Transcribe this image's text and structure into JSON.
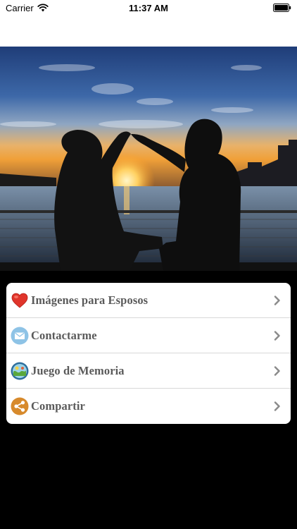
{
  "status_bar": {
    "carrier": "Carrier",
    "time": "11:37 AM"
  },
  "hero": {
    "image": "couple-silhouette-heart-sunset-photo"
  },
  "menu": {
    "items": [
      {
        "label": "Imágenes para Esposos",
        "icon": "heart-icon",
        "icon_color": "#e0352b"
      },
      {
        "label": "Contactarme",
        "icon": "mail-icon",
        "icon_color": "#8ec3e6"
      },
      {
        "label": "Juego de Memoria",
        "icon": "memory-game-icon",
        "icon_color": "#2f6e9b"
      },
      {
        "label": "Compartir",
        "icon": "share-icon",
        "icon_color": "#d78a2c"
      }
    ],
    "chevron_color": "#8a8a8a"
  },
  "colors": {
    "background": "#000000",
    "card": "#ffffff",
    "label_text": "#5a5a5a"
  }
}
